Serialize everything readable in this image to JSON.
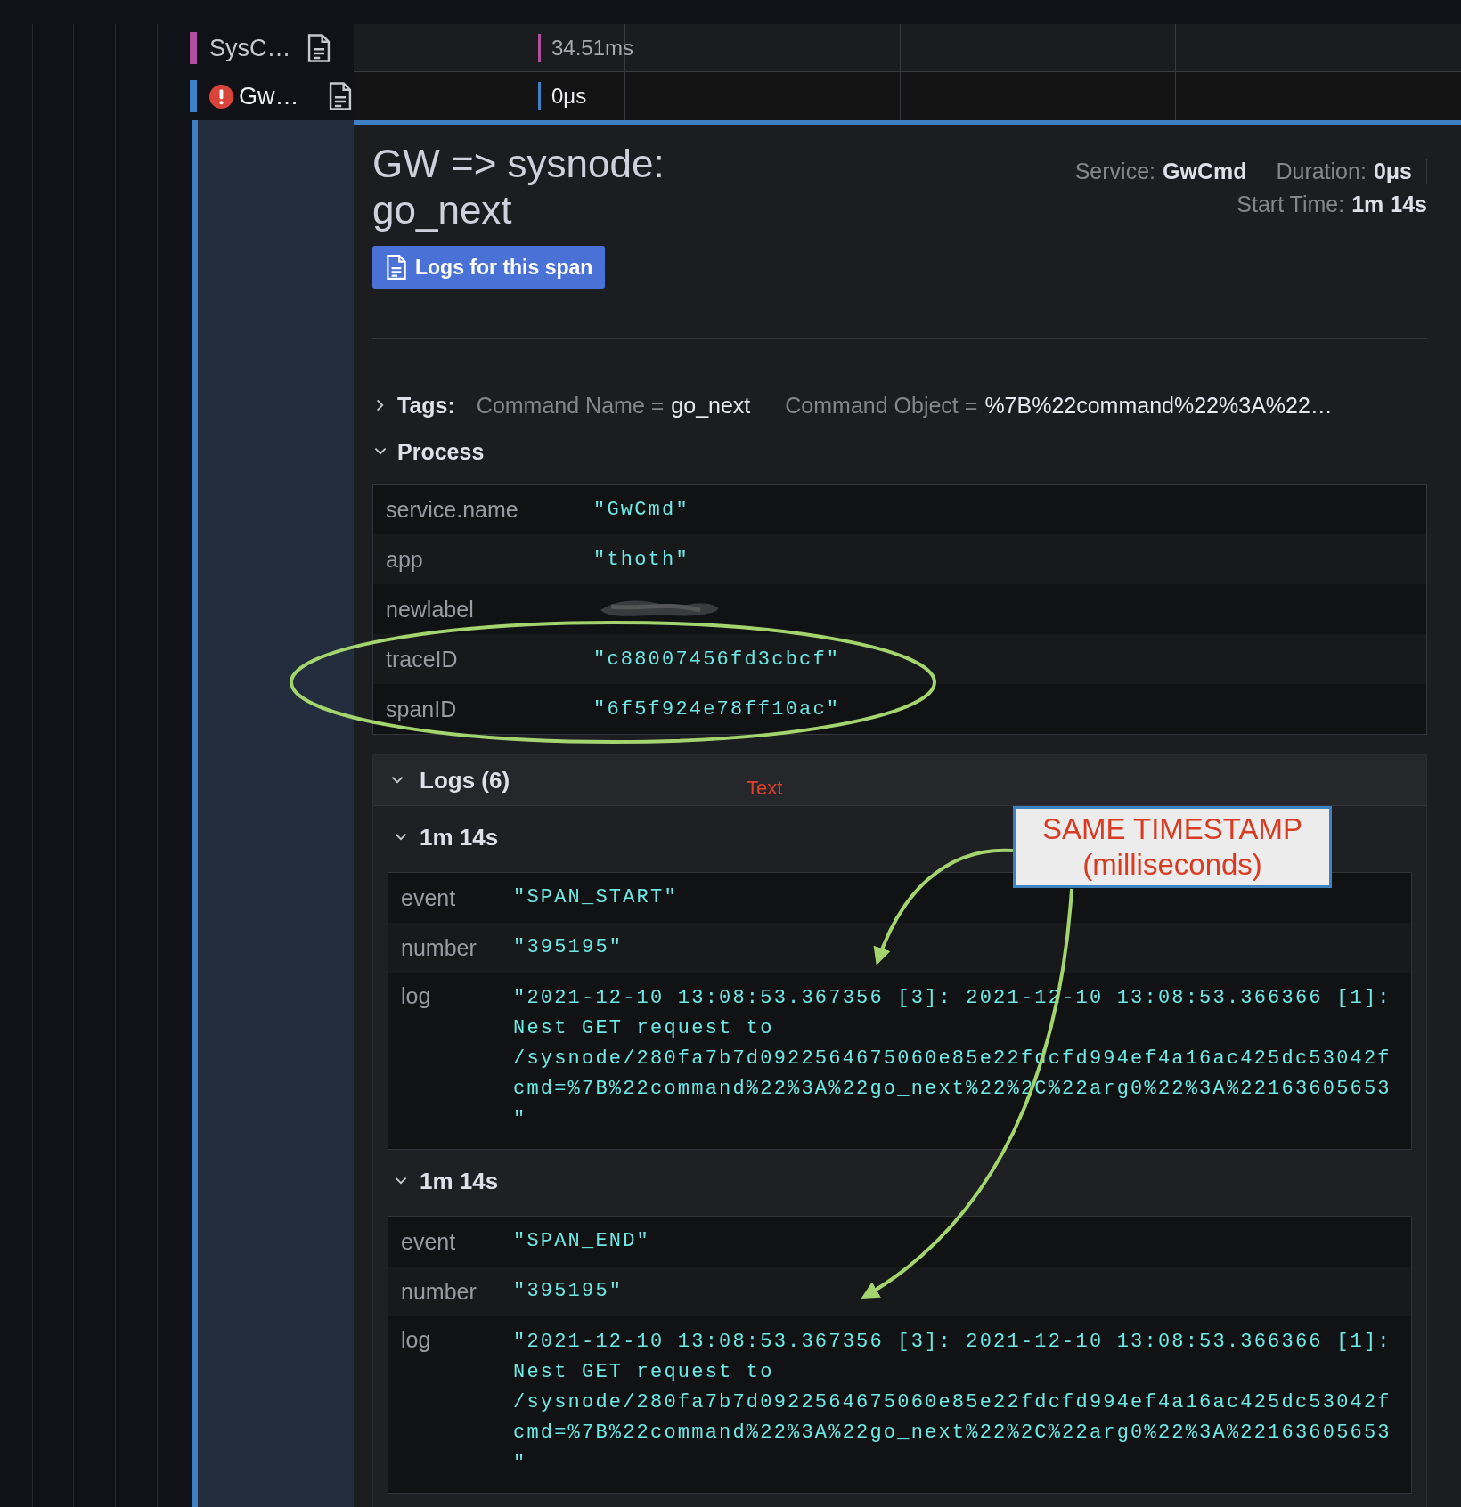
{
  "spans": [
    {
      "name": "SysC…",
      "duration": "34.51ms",
      "color": "#b04fa0",
      "error": false,
      "selected": false
    },
    {
      "name": "Gw…",
      "duration": "0μs",
      "color": "#3f7fc6",
      "error": true,
      "selected": true
    }
  ],
  "detail": {
    "title": "GW => sysnode: go_next",
    "button": "Logs for this span",
    "meta": [
      {
        "label": "Service:",
        "value": "GwCmd"
      },
      {
        "label": "Duration:",
        "value": "0μs"
      },
      {
        "label": "Start Time:",
        "value": "1m 14s"
      }
    ],
    "tags": {
      "label": "Tags:",
      "expanded": false,
      "items": [
        {
          "key": "Command Name =",
          "value": "go_next"
        },
        {
          "key": "Command Object =",
          "value": "%7B%22command%22%3A%22…"
        }
      ]
    },
    "process": {
      "label": "Process",
      "expanded": true,
      "rows": [
        {
          "key": "service.name",
          "value": "\"GwCmd\""
        },
        {
          "key": "app",
          "value": "\"thoth\""
        },
        {
          "key": "newlabel",
          "redacted": true
        },
        {
          "key": "traceID",
          "value": "\"c88007456fd3cbcf\""
        },
        {
          "key": "spanID",
          "value": "\"6f5f924e78ff10ac\""
        }
      ]
    },
    "logs": {
      "label": "Logs (6)",
      "expanded": true,
      "entries": [
        {
          "time": "1m 14s",
          "expanded": true,
          "fields": [
            {
              "key": "event",
              "lines": [
                "\"SPAN_START\""
              ]
            },
            {
              "key": "number",
              "lines": [
                "\"395195\""
              ]
            },
            {
              "key": "log",
              "lines": [
                "\"2021-12-10 13:08:53.367356 [3]: 2021-12-10 13:08:53.366366 [1]:",
                "Nest GET request to",
                "/sysnode/280fa7b7d0922564675060e85e22fdcfd994ef4a16ac425dc53042f",
                "cmd=%7B%22command%22%3A%22go_next%22%2C%22arg0%22%3A%22163605653",
                "\""
              ]
            }
          ]
        },
        {
          "time": "1m 14s",
          "expanded": true,
          "fields": [
            {
              "key": "event",
              "lines": [
                "\"SPAN_END\""
              ]
            },
            {
              "key": "number",
              "lines": [
                "\"395195\""
              ]
            },
            {
              "key": "log",
              "lines": [
                "\"2021-12-10 13:08:53.367356 [3]: 2021-12-10 13:08:53.366366 [1]:",
                "Nest GET request to",
                "/sysnode/280fa7b7d0922564675060e85e22fdcfd994ef4a16ac425dc53042f",
                "cmd=%7B%22command%22%3A%22go_next%22%2C%22arg0%22%3A%22163605653",
                "\""
              ]
            }
          ]
        }
      ]
    }
  },
  "annotations": {
    "note": "Text",
    "callout": [
      "SAME TIMESTAMP",
      "(milliseconds)"
    ]
  }
}
